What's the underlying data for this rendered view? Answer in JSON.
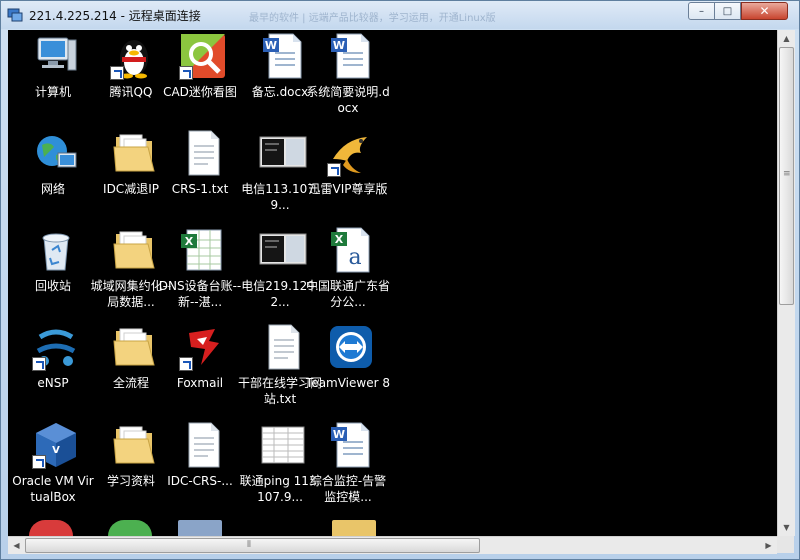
{
  "window": {
    "title": "221.4.225.214 - 远程桌面连接",
    "title_ghost": "最早的软件 | 远端产品比较器，学习运用，开通Linux版",
    "min_label": "–",
    "max_label": "□",
    "close_label": "✕"
  },
  "desktop": {
    "icons": [
      {
        "label": "计算机",
        "icon": "computer-icon",
        "shortcut": false
      },
      {
        "label": "腾讯QQ",
        "icon": "qq-penguin-icon",
        "shortcut": true
      },
      {
        "label": "CAD迷你看图",
        "icon": "cad-viewer-icon",
        "shortcut": true
      },
      {
        "label": "备忘.docx",
        "icon": "word-document-icon",
        "shortcut": false
      },
      {
        "label": "系统简要说明.docx",
        "icon": "word-document-icon",
        "shortcut": false
      },
      {
        "label": "网络",
        "icon": "network-globe-icon",
        "shortcut": false
      },
      {
        "label": "IDC减退IP",
        "icon": "folder-icon",
        "shortcut": false
      },
      {
        "label": "CRS-1.txt",
        "icon": "text-file-icon",
        "shortcut": false
      },
      {
        "label": "电信113.107.9...",
        "icon": "screenshot-image-icon",
        "shortcut": false
      },
      {
        "label": "迅雷VIP尊享版",
        "icon": "thunder-bird-icon",
        "shortcut": true
      },
      {
        "label": "回收站",
        "icon": "recycle-bin-icon",
        "shortcut": false
      },
      {
        "label": "城域网集约化--局数据...",
        "icon": "folder-icon",
        "shortcut": false
      },
      {
        "label": "DNS设备台账--新--湛...",
        "icon": "excel-spreadsheet-icon",
        "shortcut": false
      },
      {
        "label": "电信219.129.2...",
        "icon": "screenshot-image-icon",
        "shortcut": false
      },
      {
        "label": "中国联通广东省分公...",
        "icon": "excel-file-icon",
        "shortcut": false
      },
      {
        "label": "eNSP",
        "icon": "ensp-network-icon",
        "shortcut": true
      },
      {
        "label": "全流程",
        "icon": "folder-icon",
        "shortcut": false
      },
      {
        "label": "Foxmail",
        "icon": "foxmail-icon",
        "shortcut": true
      },
      {
        "label": "干部在线学习网站.txt",
        "icon": "text-file-icon",
        "shortcut": false
      },
      {
        "label": "TeamViewer 8",
        "icon": "teamviewer-icon",
        "shortcut": false
      },
      {
        "label": "Oracle VM VirtualBox",
        "icon": "virtualbox-icon",
        "shortcut": true
      },
      {
        "label": "学习资料",
        "icon": "folder-icon",
        "shortcut": false
      },
      {
        "label": "IDC-CRS-...",
        "icon": "text-file-icon",
        "shortcut": false
      },
      {
        "label": "联通ping 113.107.9...",
        "icon": "spreadsheet-image-icon",
        "shortcut": false
      },
      {
        "label": "综合监控-告警监控模...",
        "icon": "word-document-icon",
        "shortcut": false
      }
    ]
  },
  "scrollbars": {
    "up_arrow": "▲",
    "down_arrow": "▼",
    "left_arrow": "◀",
    "right_arrow": "▶"
  }
}
